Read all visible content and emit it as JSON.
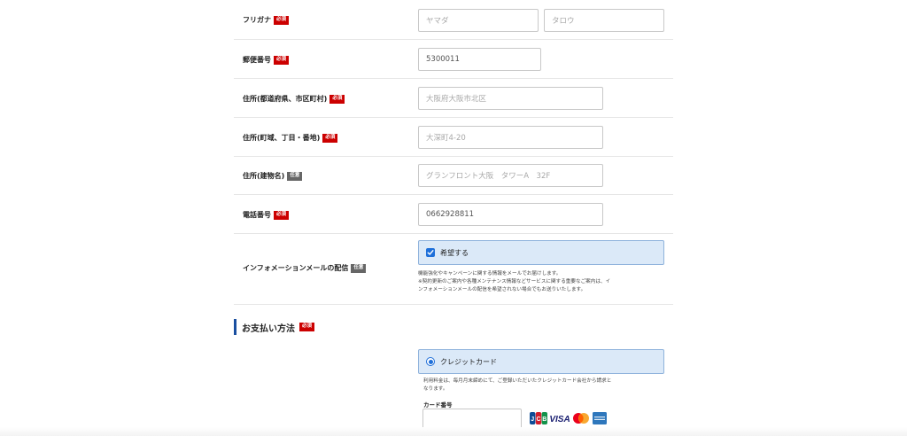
{
  "badges": {
    "required": "必須",
    "optional": "任意"
  },
  "fields": {
    "furigana": {
      "label": "フリガナ",
      "last_placeholder": "ヤマダ",
      "first_placeholder": "タロウ"
    },
    "postal": {
      "label": "郵便番号",
      "placeholder": "5300011"
    },
    "address1": {
      "label": "住所(都道府県、市区町村)",
      "placeholder": "大阪府大阪市北区"
    },
    "address2": {
      "label": "住所(町域、丁目・番地)",
      "placeholder": "大深町4-20"
    },
    "building": {
      "label": "住所(建物名)",
      "placeholder": "グランフロント大阪　タワーA　32F"
    },
    "phone": {
      "label": "電話番号",
      "placeholder": "0662928811"
    },
    "newsletter": {
      "label": "インフォメーションメールの配信",
      "option": "希望する",
      "checked": true,
      "note_line1": "機能強化やキャンペーンに関する情報をメールでお届けします。",
      "note_line2": "※契約更新のご案内や各種メンテナンス情報などサービスに関する重要なご案内は、イ",
      "note_line3": "ンフォメーションメールの配信を希望されない場合でもお送りいたします。"
    }
  },
  "payment": {
    "title": "お支払い方法",
    "option": "クレジットカード",
    "selected": true,
    "note_line1": "利用料金は、毎月月末締めにて、ご登録いただいたクレジットカード会社から請求と",
    "note_line2": "なります。",
    "card_number_label": "カード番号",
    "card_number_value": "",
    "card_brands": [
      "JCB",
      "VISA",
      "Mastercard",
      "American Express"
    ]
  },
  "colors": {
    "required_badge": "#cc0000",
    "optional_badge": "#666666",
    "selected_option_bg": "#dbe9f8",
    "accent": "#1e6fd9",
    "section_bar": "#1a4fa0"
  }
}
